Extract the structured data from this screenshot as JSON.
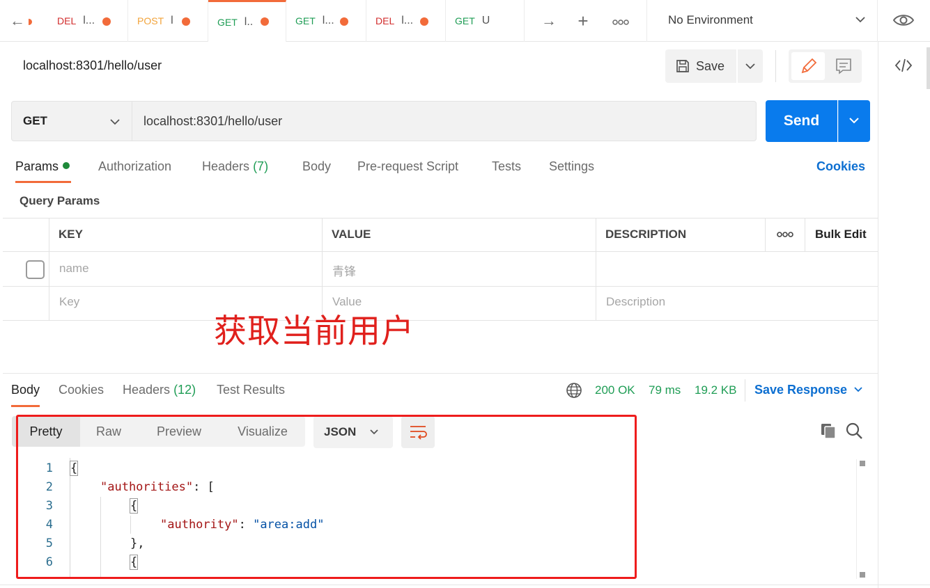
{
  "tabs": [
    {
      "method": "DEL",
      "title": "l...",
      "unsaved": true
    },
    {
      "method": "POST",
      "title": "l",
      "unsaved": true
    },
    {
      "method": "GET",
      "title": "l..",
      "unsaved": true,
      "active": true
    },
    {
      "method": "GET",
      "title": "l...",
      "unsaved": true
    },
    {
      "method": "DEL",
      "title": "l...",
      "unsaved": true
    },
    {
      "method": "GET",
      "title": "U",
      "unsaved": false
    }
  ],
  "environment": {
    "label": "No Environment"
  },
  "request": {
    "title": "localhost:8301/hello/user",
    "method": "GET",
    "url": "localhost:8301/hello/user",
    "save_label": "Save",
    "send_label": "Send"
  },
  "request_tabs": {
    "params": "Params",
    "authorization": "Authorization",
    "headers": "Headers",
    "headers_count": "(7)",
    "body": "Body",
    "prerequest": "Pre-request Script",
    "tests": "Tests",
    "settings": "Settings",
    "cookies": "Cookies"
  },
  "query_params": {
    "title": "Query Params",
    "headers": {
      "key": "KEY",
      "value": "VALUE",
      "description": "DESCRIPTION",
      "bulk_edit": "Bulk Edit"
    },
    "rows": [
      {
        "key": "name",
        "value": "青锋",
        "description": "",
        "checked": false
      }
    ],
    "placeholders": {
      "key": "Key",
      "value": "Value",
      "description": "Description"
    }
  },
  "annotation": "获取当前用户",
  "response": {
    "tabs": {
      "body": "Body",
      "cookies": "Cookies",
      "headers": "Headers",
      "headers_count": "(12)",
      "test_results": "Test Results"
    },
    "status": "200 OK",
    "time": "79 ms",
    "size": "19.2 KB",
    "save_response": "Save Response",
    "views": [
      "Pretty",
      "Raw",
      "Preview",
      "Visualize"
    ],
    "format": "JSON",
    "lines": [
      "1",
      "2",
      "3",
      "4",
      "5",
      "6"
    ],
    "code": {
      "l1": "{",
      "l2_key": "\"authorities\"",
      "l2_rest": ": [",
      "l3": "{",
      "l4_key": "\"authority\"",
      "l4_sep": ": ",
      "l4_val": "\"area:add\"",
      "l5": "},",
      "l6": "{"
    }
  },
  "colors": {
    "accent": "#f26b3a",
    "send": "#097bed",
    "link": "#0d6fd1",
    "ok": "#1f9d55",
    "annotation": "#e0201c"
  }
}
